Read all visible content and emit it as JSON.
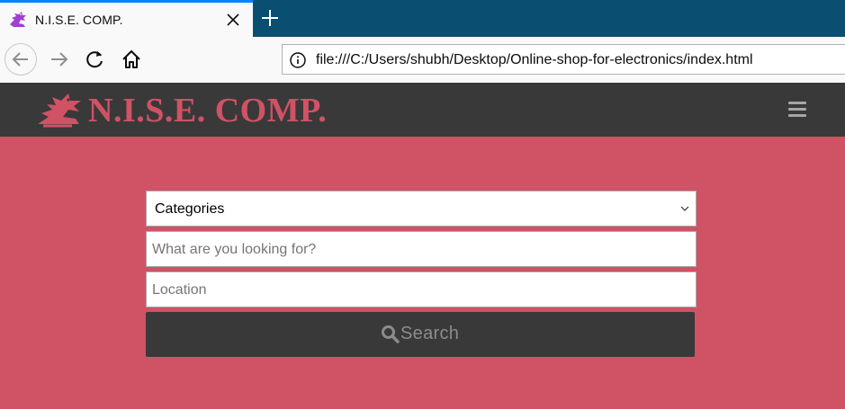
{
  "browser": {
    "tab": {
      "title": "N.I.S.E. COMP.",
      "favicon": "dragon-logo-icon",
      "close_icon": "close-icon"
    },
    "new_tab_icon": "plus-icon",
    "nav": {
      "back_icon": "back-arrow-icon",
      "forward_icon": "forward-arrow-icon",
      "reload_icon": "reload-icon",
      "home_icon": "home-icon"
    },
    "url": "file:///C:/Users/shubh/Desktop/Online-shop-for-electronics/index.html",
    "url_info_icon": "info-icon"
  },
  "site": {
    "logo_text": "N.I.S.E. COMP.",
    "logo_icon": "dragon-logo-icon",
    "menu_icon": "hamburger-menu-icon",
    "colors": {
      "brand": "#d05265",
      "header_bg": "#393939",
      "button_bg": "#393939"
    }
  },
  "search_form": {
    "category_select": {
      "selected": "Categories"
    },
    "query_input": {
      "value": "",
      "placeholder": "What are you looking for?"
    },
    "location_input": {
      "value": "",
      "placeholder": "Location"
    },
    "search_button": {
      "label": "Search",
      "icon": "search-icon"
    }
  }
}
